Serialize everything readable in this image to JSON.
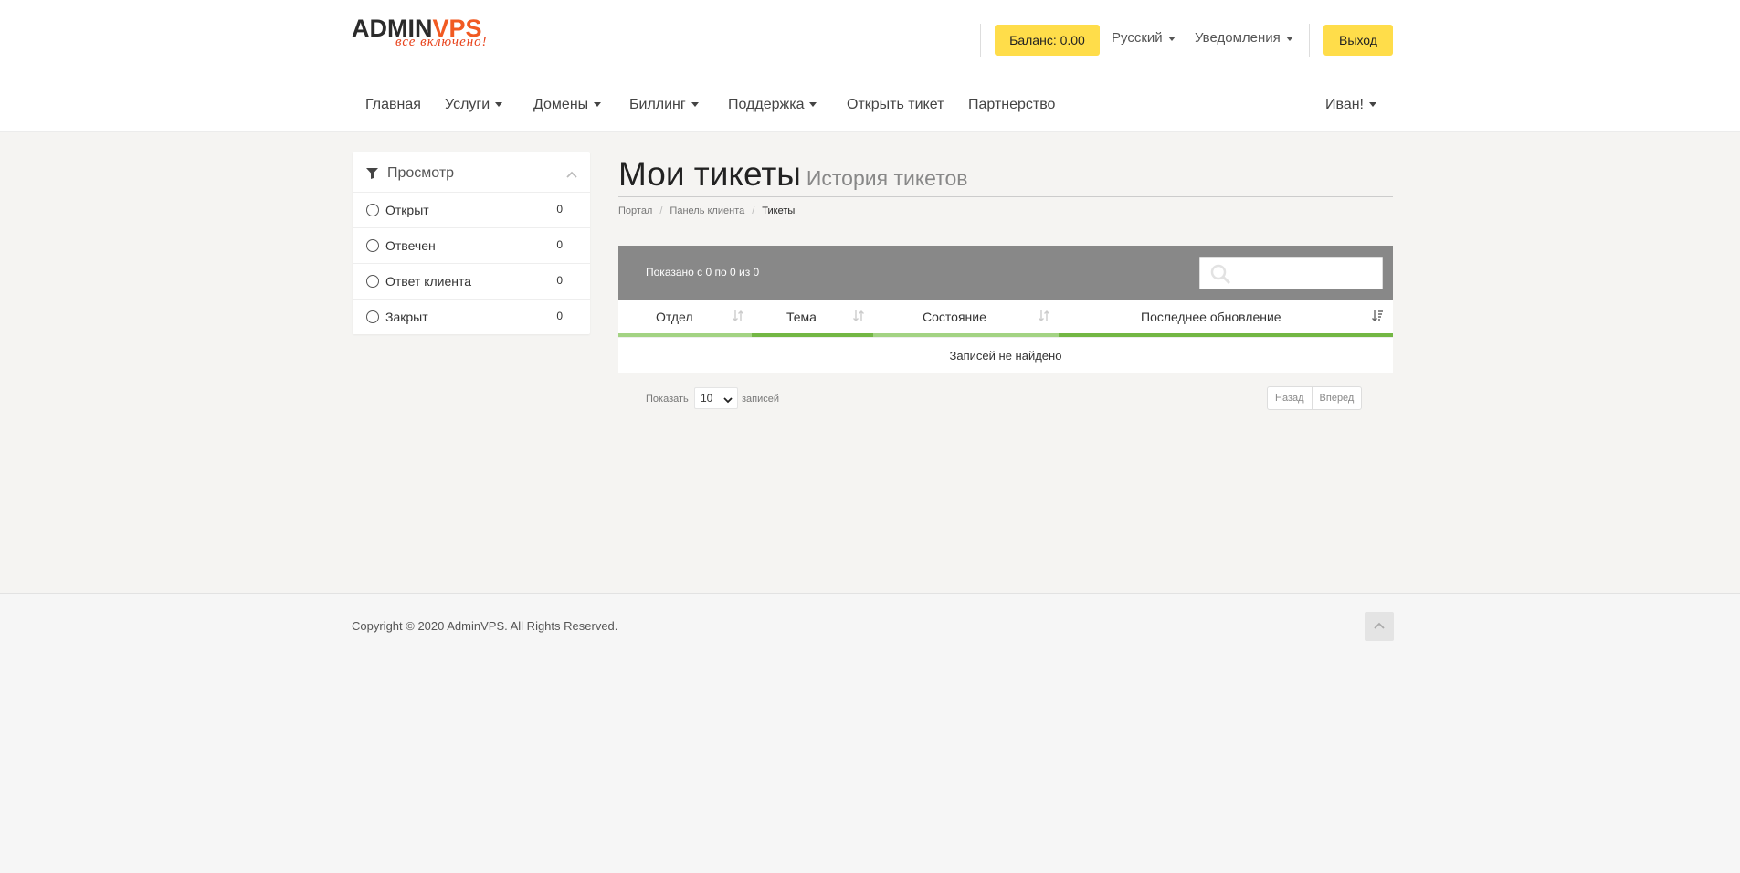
{
  "header": {
    "logo": {
      "part1": "ADMIN",
      "part2": "V",
      "part3": "PS",
      "tagline": "все включено!"
    },
    "balance_label": "Баланс: 0.00",
    "language_label": "Русский",
    "notifications_label": "Уведомления",
    "logout_label": "Выход",
    "accent_color": "#ffdd4a"
  },
  "nav": {
    "items": [
      {
        "label": "Главная",
        "dropdown": false
      },
      {
        "label": "Услуги",
        "dropdown": true
      },
      {
        "label": "Домены",
        "dropdown": true
      },
      {
        "label": "Биллинг",
        "dropdown": true
      },
      {
        "label": "Поддержка",
        "dropdown": true
      },
      {
        "label": "Открыть тикет",
        "dropdown": false
      },
      {
        "label": "Партнерство",
        "dropdown": false
      }
    ],
    "user_label": "Иван!"
  },
  "sidebar": {
    "title": "Просмотр",
    "icon": "filter-icon",
    "filters": [
      {
        "label": "Открыт",
        "count": "0"
      },
      {
        "label": "Отвечен",
        "count": "0"
      },
      {
        "label": "Ответ клиента",
        "count": "0"
      },
      {
        "label": "Закрыт",
        "count": "0"
      }
    ]
  },
  "page": {
    "title": "Мои тикеты",
    "subtitle": "История тикетов",
    "breadcrumb": [
      "Портал",
      "Панель клиента",
      "Тикеты"
    ]
  },
  "table": {
    "info": "Показано с 0 по 0 из 0",
    "search_placeholder": "",
    "columns": [
      {
        "label": "Отдел",
        "bar_color": "#a3d383"
      },
      {
        "label": "Тема",
        "bar_color": "#73b744"
      },
      {
        "label": "Состояние",
        "bar_color": "#a3d383"
      },
      {
        "label": "Последнее обновление",
        "bar_color": "#73b744"
      }
    ],
    "empty_message": "Записей не найдено",
    "length_prefix": "Показать",
    "length_value": "10",
    "length_suffix": "записей",
    "prev_label": "Назад",
    "next_label": "Вперед"
  },
  "footer": {
    "copyright": "Copyright © 2020 AdminVPS. All Rights Reserved."
  }
}
